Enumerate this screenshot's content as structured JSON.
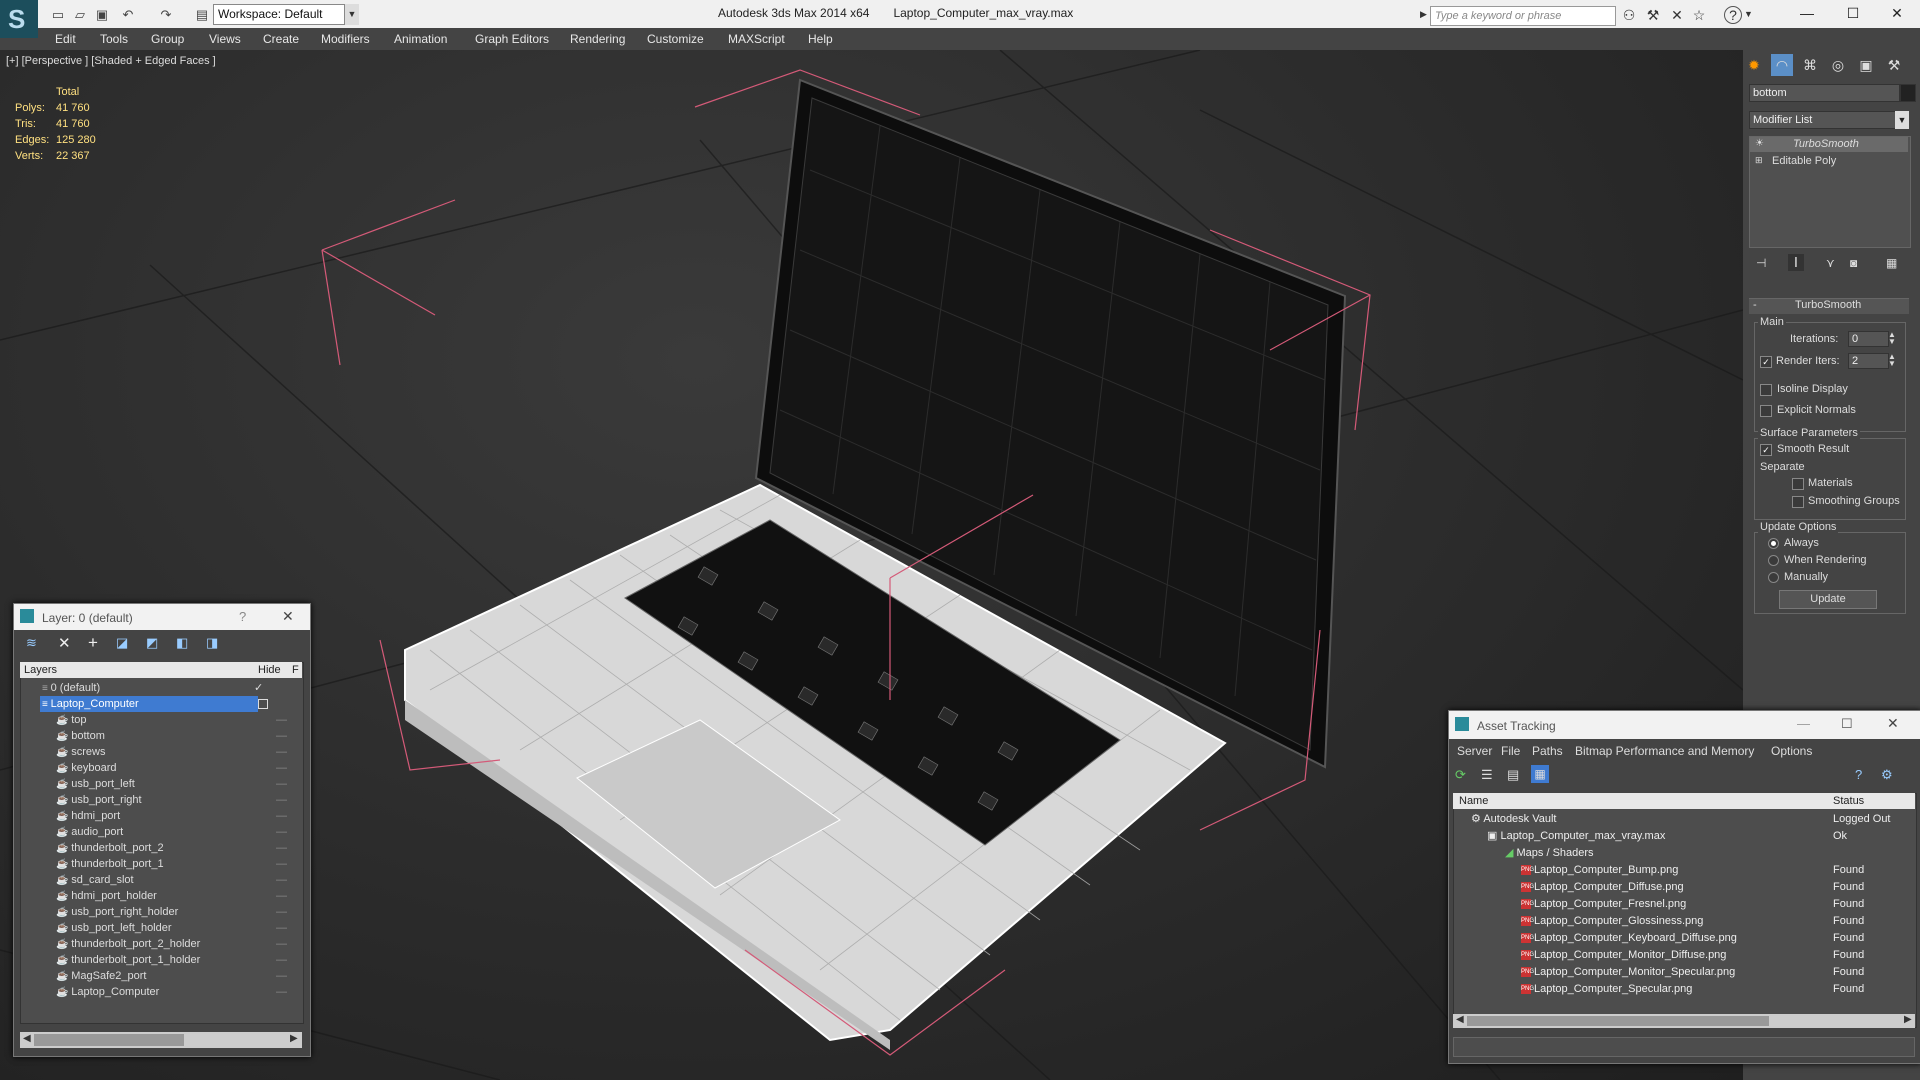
{
  "titlebar": {
    "workspace": "Workspace: Default",
    "app_name": "Autodesk 3ds Max  2014 x64",
    "file_name": "Laptop_Computer_max_vray.max",
    "search_placeholder": "Type a keyword or phrase"
  },
  "menu": [
    "Edit",
    "Tools",
    "Group",
    "Views",
    "Create",
    "Modifiers",
    "Animation",
    "Graph Editors",
    "Rendering",
    "Customize",
    "MAXScript",
    "Help"
  ],
  "viewport": {
    "label": "[+] [Perspective ] [Shaded + Edged Faces ]",
    "stats": {
      "header": "Total",
      "rows": [
        {
          "label": "Polys:",
          "value": "41 760"
        },
        {
          "label": "Tris:",
          "value": "41 760"
        },
        {
          "label": "Edges:",
          "value": "125 280"
        },
        {
          "label": "Verts:",
          "value": "22 367"
        }
      ]
    }
  },
  "command_panel": {
    "object_name": "bottom",
    "modifier_list": "Modifier List",
    "stack": [
      "TurboSmooth",
      "Editable Poly"
    ],
    "rollout_title": "TurboSmooth",
    "main_label": "Main",
    "iterations_label": "Iterations:",
    "iterations_value": "0",
    "render_iters_label": "Render Iters:",
    "render_iters_value": "2",
    "render_iters_checked": true,
    "isoline_label": "Isoline Display",
    "explicit_label": "Explicit Normals",
    "surface_label": "Surface Parameters",
    "smooth_result_label": "Smooth Result",
    "separate_label": "Separate",
    "materials_label": "Materials",
    "smoothing_groups_label": "Smoothing Groups",
    "update_options_label": "Update Options",
    "always_label": "Always",
    "when_rendering_label": "When Rendering",
    "manually_label": "Manually",
    "update_button": "Update"
  },
  "layer_window": {
    "title": "Layer: 0 (default)",
    "col_layers": "Layers",
    "col_hide": "Hide",
    "col_f": "F",
    "layers": [
      "0 (default)",
      "Laptop_Computer"
    ],
    "objects": [
      "top",
      "bottom",
      "screws",
      "keyboard",
      "usb_port_left",
      "usb_port_right",
      "hdmi_port",
      "audio_port",
      "thunderbolt_port_2",
      "thunderbolt_port_1",
      "sd_card_slot",
      "hdmi_port_holder",
      "usb_port_right_holder",
      "usb_port_left_holder",
      "thunderbolt_port_2_holder",
      "thunderbolt_port_1_holder",
      "MagSafe2_port",
      "Laptop_Computer"
    ]
  },
  "asset_window": {
    "title": "Asset Tracking",
    "menu": [
      "Server",
      "File",
      "Paths",
      "Bitmap Performance and Memory",
      "Options"
    ],
    "col_name": "Name",
    "col_status": "Status",
    "vault": {
      "name": "Autodesk Vault",
      "status": "Logged Out"
    },
    "file": {
      "name": "Laptop_Computer_max_vray.max",
      "status": "Ok"
    },
    "group": "Maps / Shaders",
    "maps": [
      {
        "name": "Laptop_Computer_Bump.png",
        "status": "Found"
      },
      {
        "name": "Laptop_Computer_Diffuse.png",
        "status": "Found"
      },
      {
        "name": "Laptop_Computer_Fresnel.png",
        "status": "Found"
      },
      {
        "name": "Laptop_Computer_Glossiness.png",
        "status": "Found"
      },
      {
        "name": "Laptop_Computer_Keyboard_Diffuse.png",
        "status": "Found"
      },
      {
        "name": "Laptop_Computer_Monitor_Diffuse.png",
        "status": "Found"
      },
      {
        "name": "Laptop_Computer_Monitor_Specular.png",
        "status": "Found"
      },
      {
        "name": "Laptop_Computer_Specular.png",
        "status": "Found"
      }
    ]
  }
}
